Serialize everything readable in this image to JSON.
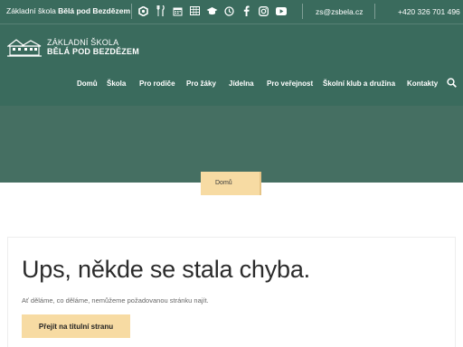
{
  "topbar": {
    "brand_normal": "Základní škola ",
    "brand_bold": "Bělá pod Bezdězem",
    "email": "zs@zsbela.cz",
    "phone": "+420 326 701 496",
    "icons": [
      "app-icon",
      "cutlery-icon",
      "calendar-icon",
      "grid-icon",
      "graduation-cap-icon",
      "clock-icon",
      "facebook-icon",
      "instagram-icon",
      "youtube-icon"
    ]
  },
  "logo": {
    "line1": "ZÁKLADNÍ ŠKOLA",
    "line2": "BĚLÁ POD BEZDĚZEM"
  },
  "nav": {
    "items": [
      "Domů",
      "Škola",
      "Pro rodiče",
      "Pro žáky",
      "Jídelna",
      "Pro veřejnost",
      "Školní klub a družina",
      "Kontakty"
    ]
  },
  "breadcrumb": {
    "home": "Domů"
  },
  "error": {
    "title": "Ups, někde se stala chyba.",
    "message": "Ať děláme, co děláme, nemůžeme požadovanou stránku najít.",
    "button": "Přejít na titulní stranu"
  },
  "colors": {
    "header": "#3a6b5d",
    "hero": "#456f62",
    "accent": "#f7dba3"
  }
}
